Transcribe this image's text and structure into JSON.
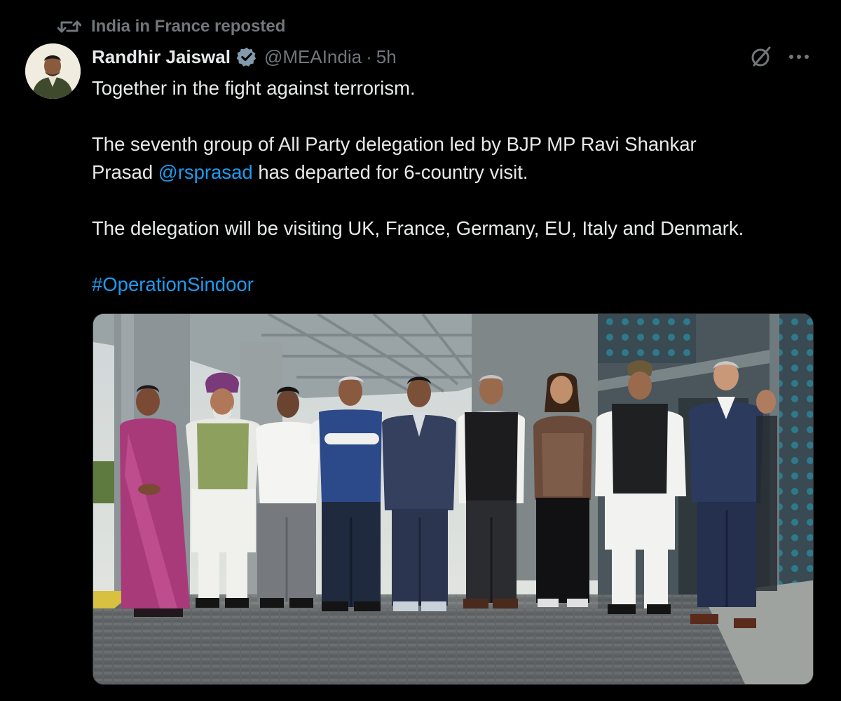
{
  "repost": {
    "text": "India in France reposted",
    "icon": "repost-icon"
  },
  "author": {
    "name": "Randhir Jaiswal",
    "verified_icon": "verified-badge-icon",
    "handle": "@MEAIndia",
    "separator": "·",
    "time": "5h",
    "avatar_icon": "avatar"
  },
  "actions": {
    "grok_icon": "grok-icon",
    "more_icon": "more-options-icon"
  },
  "tweet": {
    "line1": "Together in the fight against terrorism.",
    "line2": "The seventh group of All Party delegation led by BJP MP Ravi Shankar",
    "line3_pre": "Prasad ",
    "mention": "@rsprasad",
    "line3_post": " has departed for 6-country visit.",
    "line4": "The delegation will be visiting UK, France, Germany, EU, Italy and Denmark.",
    "hashtag": "#OperationSindoor"
  },
  "colors": {
    "background": "#000000",
    "text": "#e7e9ea",
    "muted": "#71767b",
    "link": "#1d9bf0",
    "verified": "#829aab"
  }
}
